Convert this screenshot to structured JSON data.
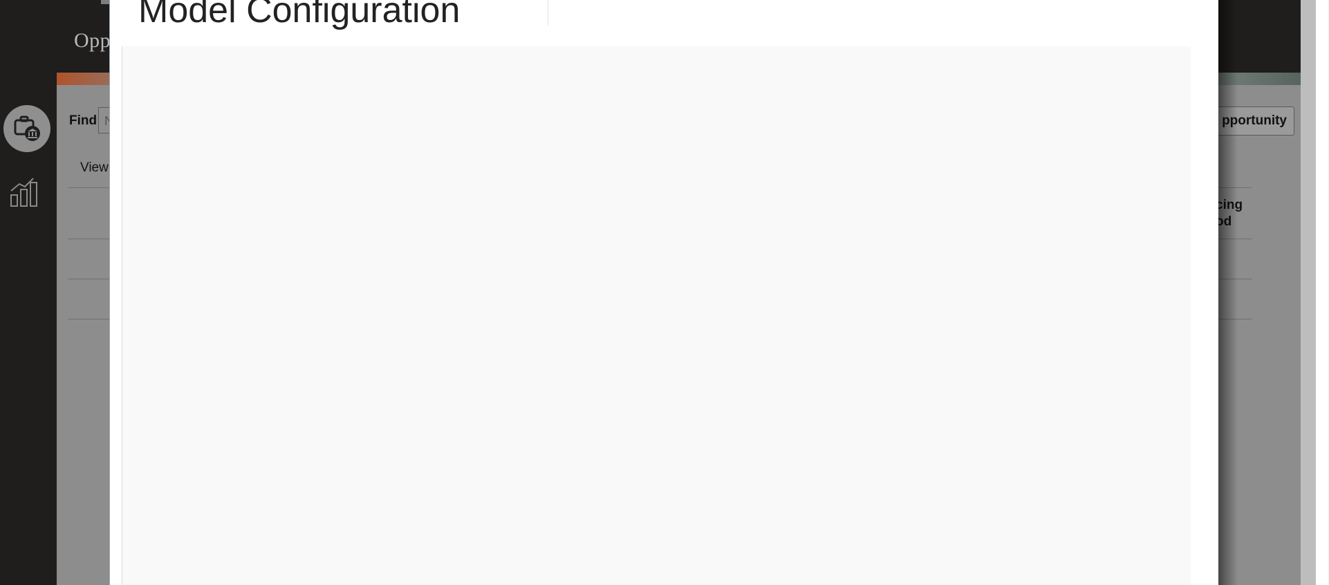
{
  "app": {
    "title": "Opp"
  },
  "toolbar": {
    "find_label": "Find",
    "find_placeholder": "N",
    "new_button_label": "pportunity"
  },
  "list": {
    "view_label": "View",
    "partial_header": "cing\nod"
  },
  "modal": {
    "title": "Model Configuration"
  },
  "icons": {
    "rail_primary": "briefcase-bank-icon",
    "rail_secondary": "bar-chart-trend-icon",
    "scroll_up": "scroll-up-arrow-icon",
    "scroll_down": "scroll-down-arrow-icon"
  },
  "colors": {
    "rail_bg": "#1f1e1c",
    "overlay": "#8d8d8d",
    "modal_bg": "#ffffff",
    "modal_body_bg": "#f9f9f9",
    "banner_accent": "#b0532c"
  }
}
